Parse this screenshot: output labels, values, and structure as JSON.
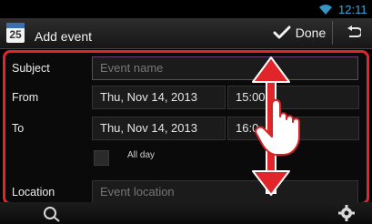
{
  "status": {
    "time": "12:11",
    "wifi_icon": "wifi-icon"
  },
  "header": {
    "app_icon_number": "25",
    "title": "Add event",
    "done_label": "Done",
    "back_icon": "back-icon"
  },
  "form": {
    "subject_label": "Subject",
    "subject_placeholder": "Event name",
    "from_label": "From",
    "from_date": "Thu, Nov 14, 2013",
    "from_time": "15:00",
    "to_label": "To",
    "to_date": "Thu, Nov 14, 2013",
    "to_time": "16:0",
    "all_day_label": "All day",
    "location_label": "Location",
    "location_placeholder": "Event location"
  },
  "overlay": {
    "annotation": "swipe-scroll-gesture"
  },
  "colors": {
    "accent": "#e0262a",
    "clock": "#3aa6d6"
  }
}
